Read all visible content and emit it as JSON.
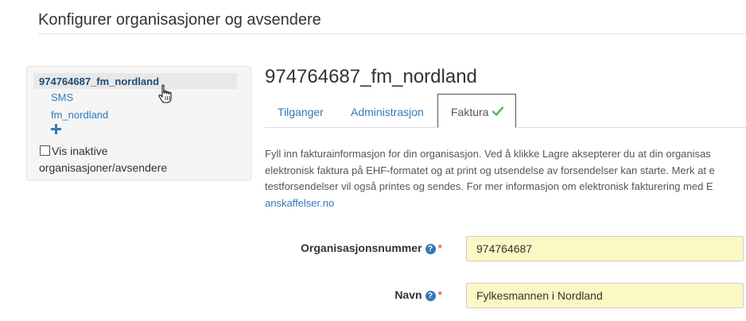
{
  "page": {
    "title": "Konfigurer organisasjoner og avsendere"
  },
  "sidebar": {
    "selected_org": "974764687_fm_nordland",
    "sub_items": [
      "SMS",
      "fm_nordland"
    ],
    "add_icon": "plus-icon",
    "show_inactive_label": "Vis inaktive organisasjoner/avsendere",
    "show_inactive_checked": false
  },
  "main": {
    "heading": "974764687_fm_nordland",
    "tabs": [
      {
        "label": "Tilganger",
        "active": false
      },
      {
        "label": "Administrasjon",
        "active": false
      },
      {
        "label": "Faktura",
        "active": true,
        "icon": "check-icon"
      }
    ],
    "intro_lines": [
      "Fyll inn fakturainformasjon for din organisasjon. Ved å klikke Lagre aksepterer du at din organisas",
      "elektronisk faktura på EHF-formatet og at print og utsendelse av forsendelser kan starte. Merk at e",
      "testforsendelser vil også printes og sendes. For mer informasjon om elektronisk fakturering med E"
    ],
    "intro_link": "anskaffelser.no"
  },
  "form": {
    "fields": [
      {
        "label": "Organisasjonsnummer",
        "help_icon": "question-icon",
        "required_mark": "*",
        "value": "974764687"
      },
      {
        "label": "Navn",
        "help_icon": "question-icon",
        "required_mark": "*",
        "value": "Fylkesmannen i Nordland"
      }
    ]
  },
  "colors": {
    "link": "#337ab7",
    "selected_org_text": "#1e4b75",
    "input_background": "#fcf8c4",
    "check": "#5cb85c",
    "required": "#c9302c"
  }
}
